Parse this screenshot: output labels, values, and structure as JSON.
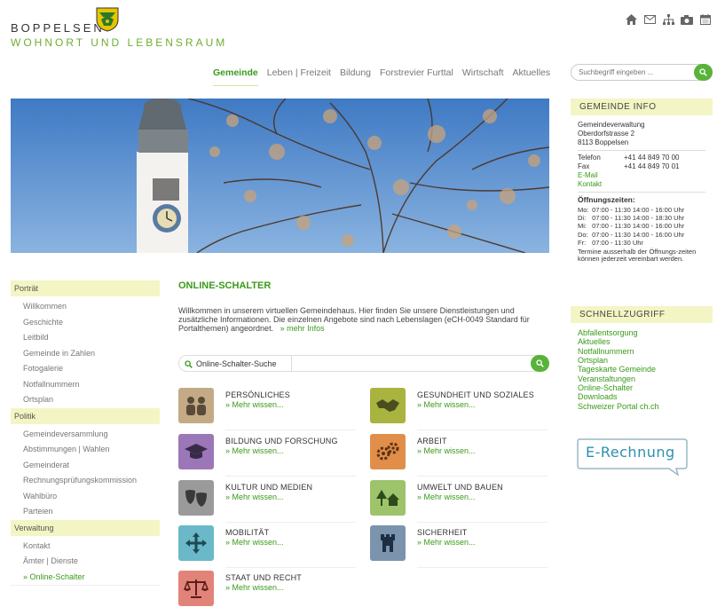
{
  "header": {
    "logo_name": "BOPPELSEN",
    "logo_sub": "WOHNORT UND LEBENSRAUM",
    "top_icons": [
      "home-icon",
      "mail-icon",
      "sitemap-icon",
      "camera-icon",
      "calendar-icon"
    ]
  },
  "nav": {
    "items": [
      "Gemeinde",
      "Leben | Freizeit",
      "Bildung",
      "Forstrevier Furttal",
      "Wirtschaft",
      "Aktuelles"
    ],
    "active": "Gemeinde"
  },
  "search": {
    "placeholder": "Suchbegriff eingeben ..."
  },
  "sidebar": {
    "sections": [
      {
        "label": "Porträt",
        "items": [
          "Willkommen",
          "Geschichte",
          "Leitbild",
          "Gemeinde in Zahlen",
          "Fotogalerie",
          "Notfallnummern",
          "Ortsplan"
        ]
      },
      {
        "label": "Politik",
        "items": [
          "Gemeindeversammlung",
          "Abstimmungen | Wahlen",
          "Gemeinderat",
          "Rechnungsprüfungskommission",
          "Wahlbüro",
          "Parteien"
        ]
      },
      {
        "label": "Verwaltung",
        "items": [
          "Kontakt",
          "Ämter | Dienste",
          "» Online-Schalter"
        ]
      }
    ]
  },
  "main": {
    "title": "ONLINE-SCHALTER",
    "intro": "Willkommen in unserem virtuellen Gemeindehaus. Hier finden Sie unsere Dienstleistungen und zusätzliche Informationen. Die einzelnen Angebote sind nach Lebenslagen (eCH-0049 Standard für Portalthemen) angeordnet.",
    "intro_link": "» mehr Infos",
    "search_label": "Online-Schalter-Suche",
    "more_label": "» Mehr wissen...",
    "categories": [
      {
        "title": "PERSÖNLICHES",
        "color": "#c4ab85",
        "icon": "people-icon"
      },
      {
        "title": "GESUNDHEIT UND SOZIALES",
        "color": "#a9b33f",
        "icon": "handshake-icon"
      },
      {
        "title": "BILDUNG UND FORSCHUNG",
        "color": "#9b77b8",
        "icon": "graduation-cap-icon"
      },
      {
        "title": "ARBEIT",
        "color": "#e08e4a",
        "icon": "gears-icon"
      },
      {
        "title": "KULTUR UND MEDIEN",
        "color": "#9a9a9a",
        "icon": "theater-masks-icon"
      },
      {
        "title": "UMWELT UND BAUEN",
        "color": "#9dc46a",
        "icon": "trees-house-icon"
      },
      {
        "title": "MOBILITÄT",
        "color": "#6ab8c8",
        "icon": "move-arrows-icon"
      },
      {
        "title": "SICHERHEIT",
        "color": "#7b93ad",
        "icon": "tower-icon"
      },
      {
        "title": "STAAT UND RECHT",
        "color": "#e2837a",
        "icon": "scales-icon"
      }
    ]
  },
  "info": {
    "header": "GEMEINDE INFO",
    "org": "Gemeindeverwaltung",
    "street": "Oberdorfstrasse 2",
    "city": "8113 Boppelsen",
    "phone_label": "Telefon",
    "phone": "+41 44 849 70 00",
    "fax_label": "Fax",
    "fax": "+41 44 849 70 01",
    "email": "E-Mail",
    "contact": "Kontakt",
    "hours_title": "Öffnungszeiten:",
    "hours": [
      {
        "day": "Mo:",
        "time": "07:00 - 11:30 14:00 - 16:00 Uhr"
      },
      {
        "day": "Di:",
        "time": "07:00 - 11:30 14:00 - 18:30 Uhr"
      },
      {
        "day": "Mi:",
        "time": "07:00 - 11:30 14:00 - 16:00 Uhr"
      },
      {
        "day": "Do:",
        "time": "07:00 - 11:30 14:00 - 16:00 Uhr"
      },
      {
        "day": "Fr:",
        "time": "07:00 - 11:30 Uhr"
      }
    ],
    "note": "Termine ausserhalb der Öffnungs-zeiten können jederzeit vereinbart werden."
  },
  "quick": {
    "header": "SCHNELLZUGRIFF",
    "links": [
      "Abfallentsorgung",
      "Aktuelles",
      "Notfallnummern",
      "Ortsplan",
      "Tageskarte Gemeinde",
      "Veranstaltungen",
      "Online-Schalter",
      "Downloads",
      "Schweizer Portal ch.ch"
    ]
  },
  "erechnung": {
    "label": "E-Rechnung"
  },
  "colors": {
    "accent": "#3a9a1a",
    "button": "#58b33a",
    "highlight": "#f4f5c4"
  }
}
